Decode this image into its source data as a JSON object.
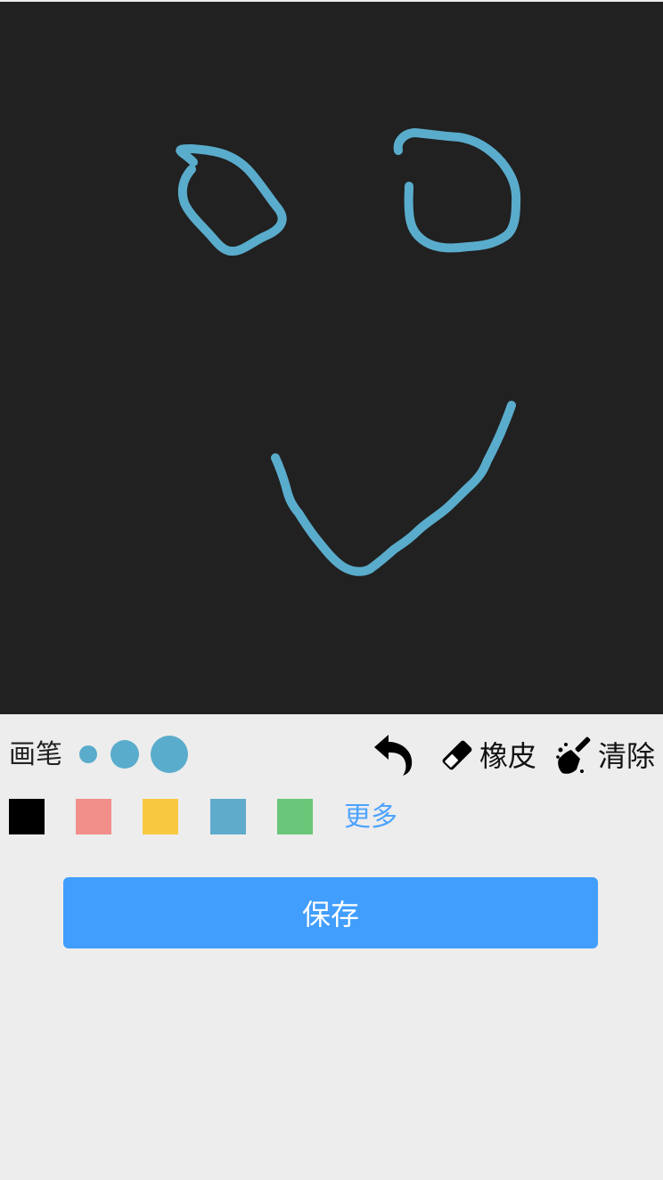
{
  "canvas": {
    "background": "#212121",
    "stroke_color": "#5aaccc"
  },
  "toolbar": {
    "pen_label": "画笔",
    "brush_sizes": [
      "small",
      "medium",
      "large"
    ],
    "brush_color": "#5aaccc",
    "undo_icon": "undo-arrow-icon",
    "eraser_label": "橡皮",
    "eraser_icon": "eraser-icon",
    "clear_label": "清除",
    "clear_icon": "broom-icon"
  },
  "palette": {
    "colors": [
      "#000000",
      "#f28f8b",
      "#f8c940",
      "#5fabcb",
      "#6ac679"
    ],
    "more_label": "更多",
    "more_color": "#4da3ff"
  },
  "save": {
    "label": "保存",
    "color": "#419efc"
  }
}
